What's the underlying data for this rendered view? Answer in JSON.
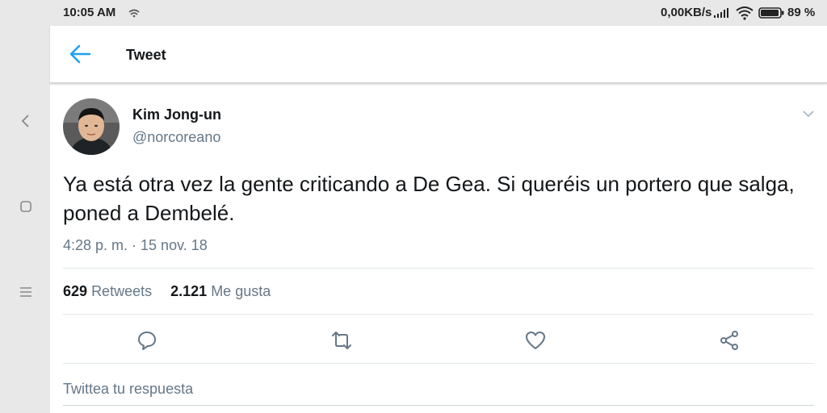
{
  "status_bar": {
    "time": "10:05 AM",
    "network_speed": "0,00KB/s",
    "battery": "89 %"
  },
  "app_bar": {
    "title": "Tweet",
    "back_icon": "arrow-left-icon"
  },
  "tweet": {
    "display_name": "Kim Jong-un",
    "handle": "@norcoreano",
    "text": "Ya está otra vez la gente criticando a De Gea. Si queréis un portero que salga, poned a Dembelé.",
    "timestamp": "4:28 p. m. · 15 nov. 18",
    "retweets_count": "629",
    "retweets_label": "Retweets",
    "likes_count": "2.121",
    "likes_label": "Me gusta"
  },
  "actions": [
    "reply-icon",
    "retweet-icon",
    "like-icon",
    "share-icon"
  ],
  "reply_box": {
    "placeholder": "Twittea tu respuesta"
  },
  "colors": {
    "accent": "#1da1f2",
    "secondary_text": "#657786",
    "primary_text": "#14171a"
  }
}
